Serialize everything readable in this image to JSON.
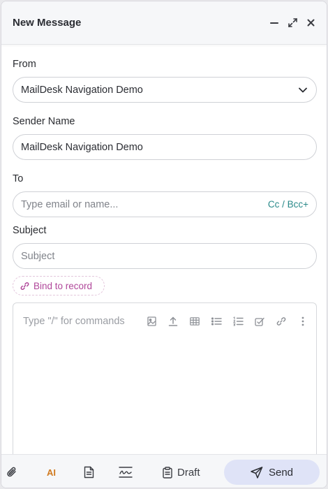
{
  "header": {
    "title": "New Message"
  },
  "form": {
    "from_label": "From",
    "from_value": "MailDesk Navigation Demo",
    "sender_label": "Sender Name",
    "sender_value": "MailDesk Navigation Demo",
    "to_label": "To",
    "to_placeholder": "Type email or name...",
    "cc_bcc": "Cc / Bcc+",
    "subject_label": "Subject",
    "subject_placeholder": "Subject",
    "bind_label": "Bind to record"
  },
  "editor": {
    "placeholder": "Type \"/\" for commands"
  },
  "footer": {
    "draft_label": "Draft",
    "send_label": "Send",
    "ai_label": "AI"
  },
  "colors": {
    "accent": "#b0479a",
    "send_bg": "#dfe3f7",
    "cc_color": "#2a8a8a"
  }
}
